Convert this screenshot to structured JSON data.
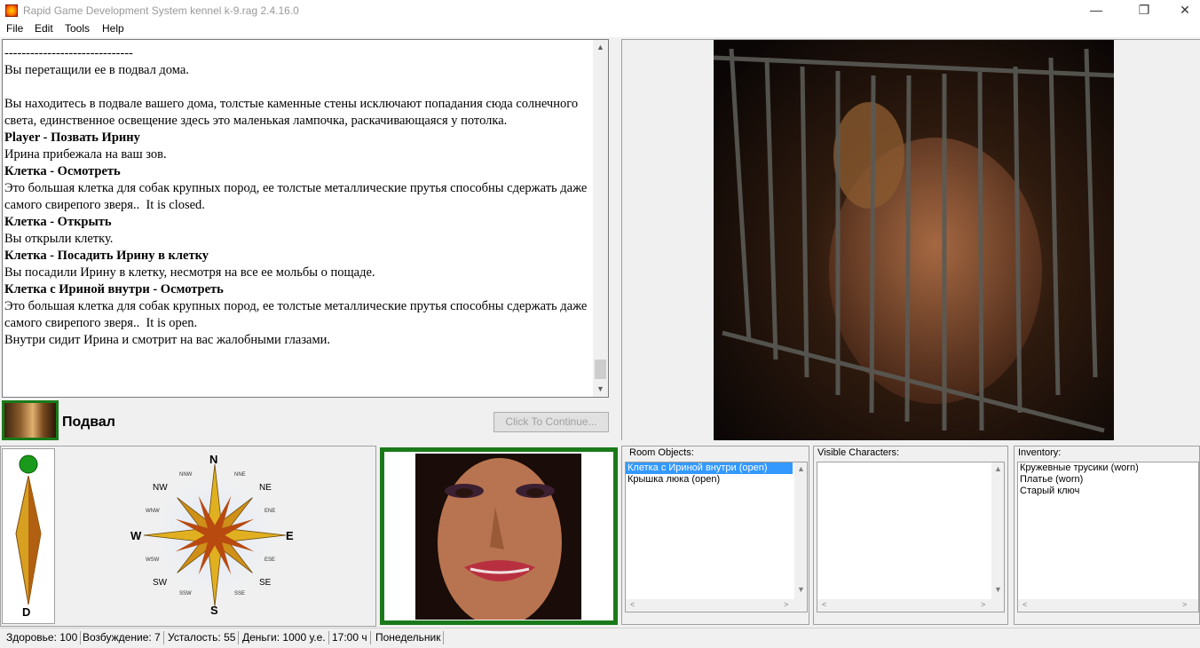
{
  "window": {
    "title": "Rapid Game Development System kennel k-9.rag 2.4.16.0",
    "minimize_glyph": "—",
    "maximize_glyph": "❐",
    "close_glyph": "✕"
  },
  "menu": [
    "File",
    "Edit",
    "Tools",
    "Help"
  ],
  "log": {
    "lines": [
      {
        "text": "------------------------------",
        "bold": false
      },
      {
        "text": "Вы перетащили ее в подвал дома.",
        "bold": false
      },
      {
        "text": " ",
        "bold": false
      },
      {
        "text": "Вы находитесь в подвале вашего дома, толстые каменные стены исключают попадания сюда солнечного света, единственное освещение здесь это маленькая лампочка, раскачивающаяся у потолка.",
        "bold": false
      },
      {
        "text": "Player - Позвать Ирину",
        "bold": true
      },
      {
        "text": "Ирина прибежала на ваш зов.",
        "bold": false
      },
      {
        "text": "Клетка - Осмотреть",
        "bold": true
      },
      {
        "text": "Это большая клетка для собак крупных пород, ее толстые металлические прутья способны сдержать даже самого свирепого зверя..  It is closed.",
        "bold": false
      },
      {
        "text": "Клетка - Открыть",
        "bold": true
      },
      {
        "text": "Вы открыли клетку.",
        "bold": false
      },
      {
        "text": "Клетка - Посадить Ирину в клетку",
        "bold": true
      },
      {
        "text": "Вы посадили Ирину в клетку, несмотря на все ее мольбы о пощаде.",
        "bold": false
      },
      {
        "text": "Клетка с Ириной внутри - Осмотреть",
        "bold": true
      },
      {
        "text": "Это большая клетка для собак крупных пород, ее толстые металлические прутья способны сдержать даже самого свирепого зверя..  It is open.",
        "bold": false
      },
      {
        "text": "Внутри сидит Ирина и смотрит на вас жалобными глазами.",
        "bold": false
      }
    ]
  },
  "location": {
    "name": "Подвал",
    "continue_label": "Click To Continue..."
  },
  "compass": {
    "N": "N",
    "S": "S",
    "E": "E",
    "W": "W",
    "NE": "NE",
    "NW": "NW",
    "SE": "SE",
    "SW": "SW",
    "NNE": "NNE",
    "NNW": "NNW",
    "ENE": "ENE",
    "ESE": "ESE",
    "SSE": "SSE",
    "SSW": "SSW",
    "WNW": "WNW",
    "WSW": "WSW",
    "down": "D"
  },
  "room_objects": {
    "title": "Room Objects:",
    "items": [
      "Клетка с Ириной внутри (open)",
      "Крышка люка (open)"
    ],
    "selected_index": 0
  },
  "visible_characters": {
    "title": "Visible Characters:",
    "items": []
  },
  "inventory": {
    "title": "Inventory:",
    "items": [
      "Кружевные трусики (worn)",
      "Платье (worn)",
      "Старый ключ"
    ]
  },
  "status": [
    "Здоровье: 100",
    "Возбуждение: 7",
    "Усталость: 55",
    "Деньги: 1000 у.е.",
    "17:00 ч",
    "Понедельник"
  ],
  "colors": {
    "selection": "#3399ff",
    "frame_green": "#1a7a1a",
    "compass_gold": "#e0b020"
  },
  "icons": {
    "app": "app-icon",
    "scroll_up": "▲",
    "scroll_down": "▼",
    "scroll_left": "<",
    "scroll_right": ">"
  }
}
